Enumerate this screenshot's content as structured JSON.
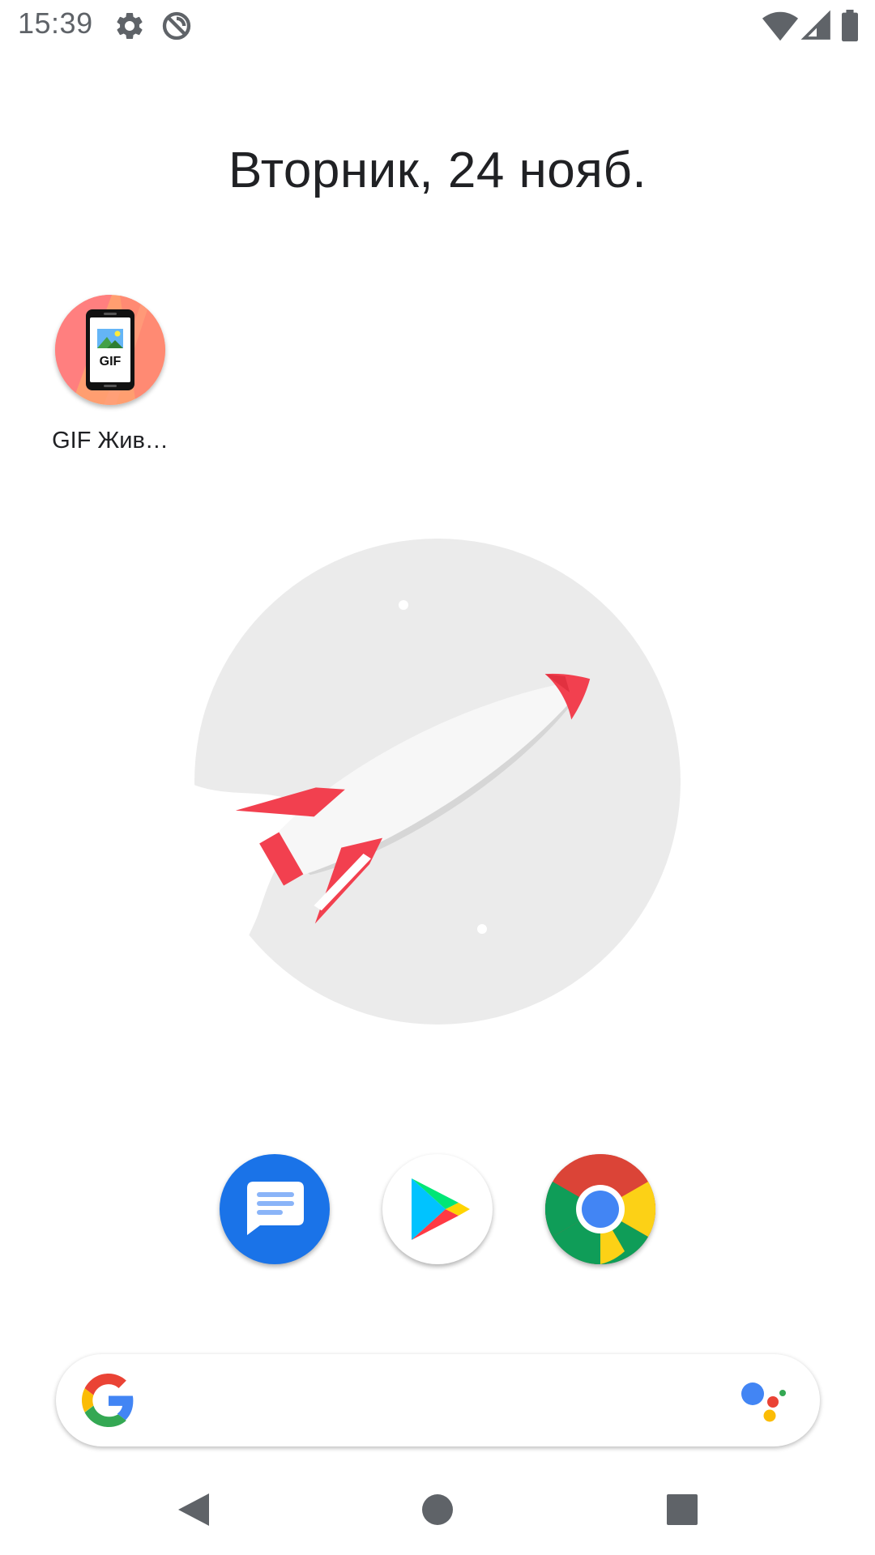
{
  "status_bar": {
    "time": "15:39",
    "left_icons": [
      "settings-icon",
      "do-not-disturb-icon"
    ],
    "right_icons": [
      "wifi-icon",
      "cellular-signal-icon",
      "battery-icon"
    ]
  },
  "home": {
    "date": "Вторник, 24 нояб.",
    "apps": [
      {
        "label": "GIF Жив…",
        "icon": "gif-live-wallpaper-icon",
        "accent": "#ff8a80"
      }
    ]
  },
  "illustration": {
    "icon": "rocket-icon",
    "colors": {
      "circle": "#ebebeb",
      "body": "#f5f5f5",
      "fins": "#f2404f"
    }
  },
  "dock": {
    "apps": [
      {
        "name": "messages",
        "icon": "messages-icon",
        "color": "#1a73e8"
      },
      {
        "name": "play-store",
        "icon": "play-store-icon",
        "color": "#ffffff"
      },
      {
        "name": "chrome",
        "icon": "chrome-icon",
        "color": "#db4437"
      }
    ]
  },
  "search_bar": {
    "left_icon": "google-g-icon",
    "right_icon": "google-assistant-icon",
    "colors": [
      "#4285f4",
      "#ea4335",
      "#fbbc05",
      "#34a853"
    ]
  },
  "nav_bar": {
    "buttons": [
      "back-icon",
      "home-icon",
      "recents-icon"
    ],
    "color": "#5f6368"
  }
}
